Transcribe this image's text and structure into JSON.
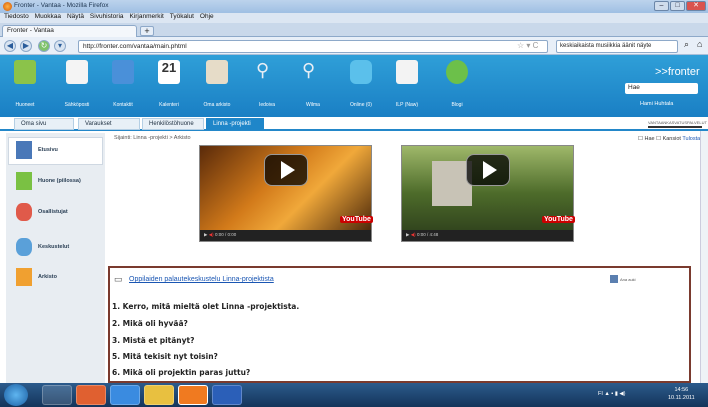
{
  "window": {
    "title": "Fronter - Vantaa - Mozilla Firefox",
    "min": "–",
    "max": "□",
    "close": "✕"
  },
  "menu": [
    "Tiedosto",
    "Muokkaa",
    "Näytä",
    "Sivuhistoria",
    "Kirjanmerkit",
    "Työkalut",
    "Ohje"
  ],
  "tab": {
    "label": "Fronter - Vantaa",
    "plus": "+"
  },
  "nav": {
    "back": "◀",
    "forward": "▶",
    "url": "http://fronter.com/vantaa/main.phtml",
    "search": "keskiaikaista musiikkia äänin äyte",
    "search_full": "keskiaikaista musiikkia äänit näyte"
  },
  "header": {
    "icons": [
      "Huoneet",
      "Sähköposti",
      "Kontaktit",
      "Kalenteri",
      "Oma arkisto",
      "Iedoiva",
      "Wilma",
      "Online (0)",
      "ILP (Naw)",
      "Blogi"
    ],
    "logo": ">>fronter",
    "search": "Hae",
    "user": "Hami Huhtala"
  },
  "subtabs": [
    "Oma sivu",
    "Varaukset",
    "Henkilöstöhuone",
    "Linna -projekti"
  ],
  "subright": "VANTAANKASVATUSPALVELUT",
  "sidebar": [
    "Etusivu",
    "Huone (piilossa)",
    "Osallistujat",
    "Keskustelut",
    "Arkisto"
  ],
  "crumb": "Sijainti: Linna -projekti > Arkisto",
  "checks": {
    "hae": "Hae",
    "kansiot": "Kansiot",
    "tulosta": "Tulosta"
  },
  "videos": [
    {
      "time": "0:00 / 0:00"
    },
    {
      "time": "0:00 / 4:48"
    }
  ],
  "yt": "YouTube",
  "forum": {
    "title": "Oppilaiden palautekeskustelu Linna-projektista",
    "side": "Ana auki",
    "questions": [
      "1. Kerro, mitä mieltä olet Linna -projektista.",
      "2. Mikä oli hyvää?",
      "3. Mistä et pitänyt?",
      "5. Mitä tekisit nyt toisin?",
      "6. Mikä oli projektin paras juttu?"
    ]
  },
  "clock": {
    "time": "14:56",
    "date": "10.11.2011"
  },
  "colors": {
    "header": "#2387c9",
    "forum_border": "#7a3a2e",
    "active_tab": "#1f86c9"
  }
}
